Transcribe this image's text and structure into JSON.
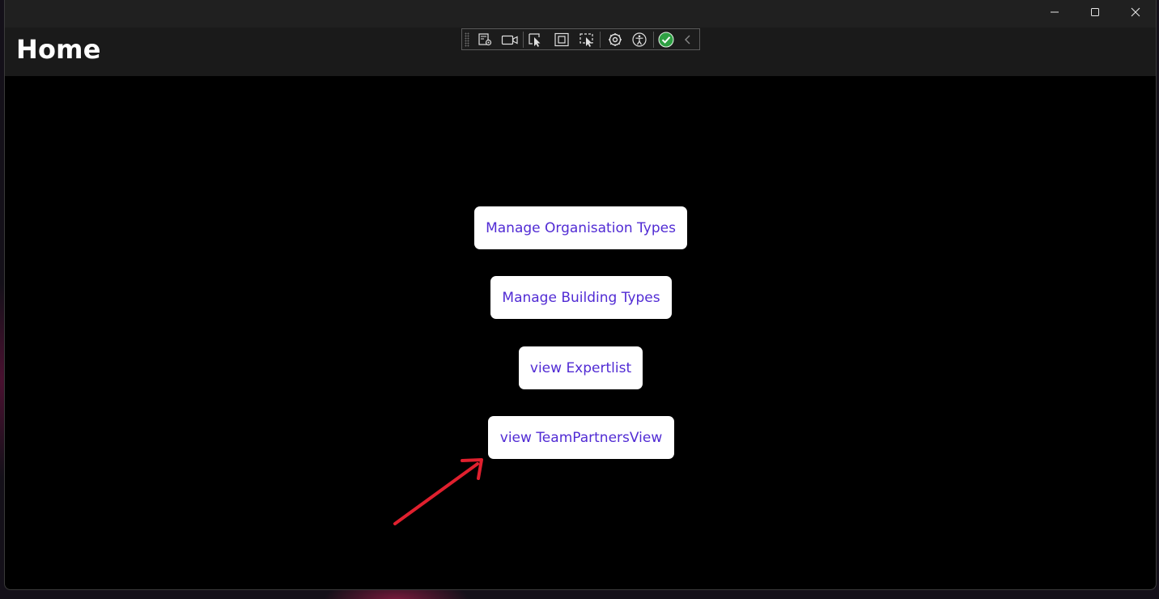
{
  "window": {
    "caption_buttons": {
      "minimize_icon": "minimize-icon",
      "maximize_icon": "maximize-icon",
      "close_icon": "close-icon"
    }
  },
  "header": {
    "title": "Home"
  },
  "dev_toolbar": {
    "tools": [
      "live-visual-tree-icon",
      "record-icon",
      "select-element-icon",
      "display-layout-adorners-icon",
      "track-focused-element-icon",
      "hot-reload-icon",
      "accessibility-icon",
      "binding-failures-check-icon",
      "collapse-chevron-icon"
    ],
    "check_color": "#2ea043"
  },
  "main": {
    "buttons": [
      {
        "label": "Manage Organisation Types"
      },
      {
        "label": "Manage Building Types"
      },
      {
        "label": "view Expertlist"
      },
      {
        "label": "view TeamPartnersView"
      }
    ]
  },
  "colors": {
    "button_text": "#512bd4",
    "button_bg": "#ffffff",
    "page_bg": "#000000",
    "header_bg": "#1a1a1a",
    "annotation_arrow": "#e0202e"
  }
}
